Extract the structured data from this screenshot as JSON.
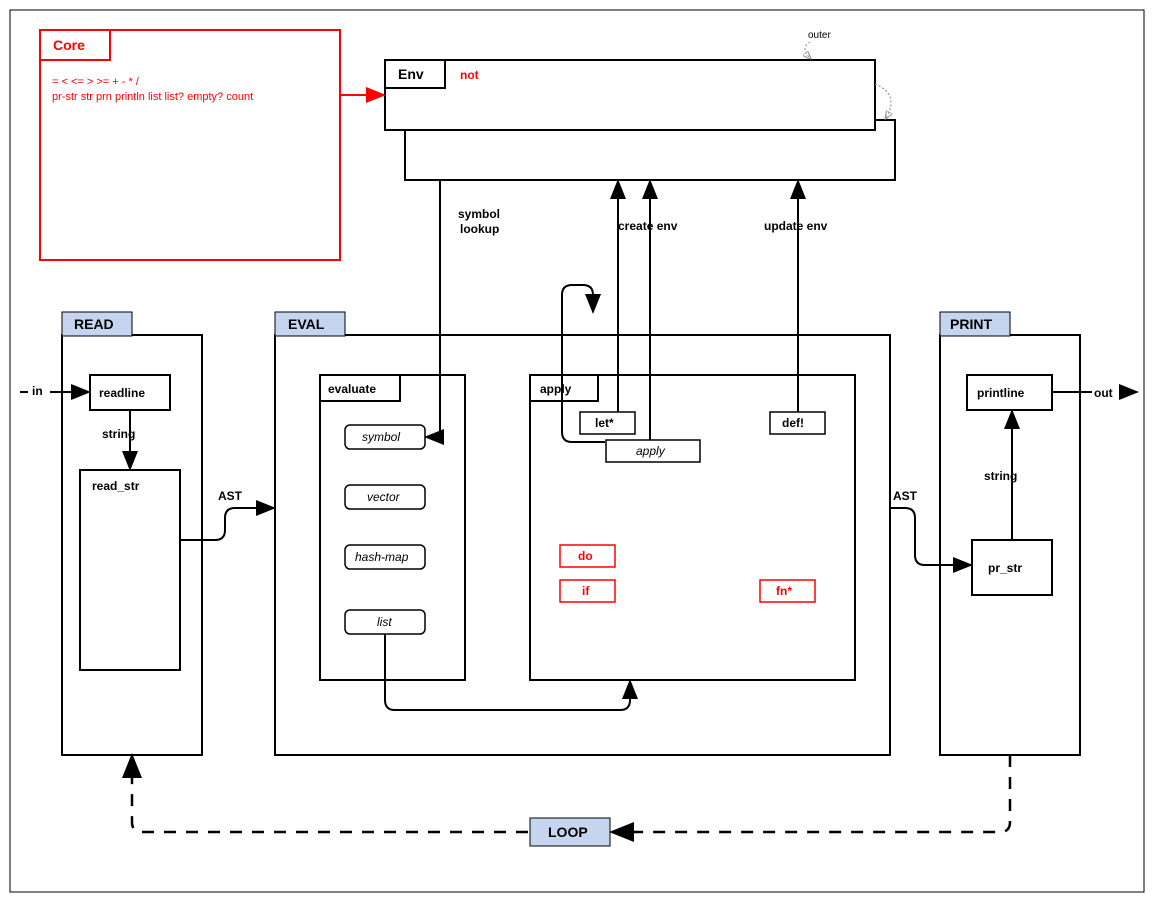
{
  "core": {
    "title": "Core",
    "line1": "= < <= > >= + - * /",
    "line2": "pr-str str prn println list list? empty? count"
  },
  "env": {
    "title": "Env",
    "content": "not",
    "outer_label": "outer"
  },
  "read": {
    "title": "READ",
    "readline": "readline",
    "read_str": "read_str",
    "in_label": "in",
    "string_label": "string"
  },
  "eval": {
    "title": "EVAL",
    "evaluate": {
      "title": "evaluate",
      "items": [
        "symbol",
        "vector",
        "hash-map",
        "list"
      ]
    },
    "apply": {
      "title": "apply",
      "let_star": "let*",
      "apply_inner": "apply",
      "def_bang": "def!",
      "do": "do",
      "if": "if",
      "fn_star": "fn*"
    }
  },
  "print": {
    "title": "PRINT",
    "printline": "printline",
    "pr_str": "pr_str",
    "out_label": "out",
    "string_label": "string"
  },
  "loop": {
    "title": "LOOP"
  },
  "arrows": {
    "symbol_lookup": "symbol",
    "symbol_lookup2": "lookup",
    "create_env": "create env",
    "update_env": "update env",
    "ast1": "AST",
    "ast2": "AST"
  }
}
